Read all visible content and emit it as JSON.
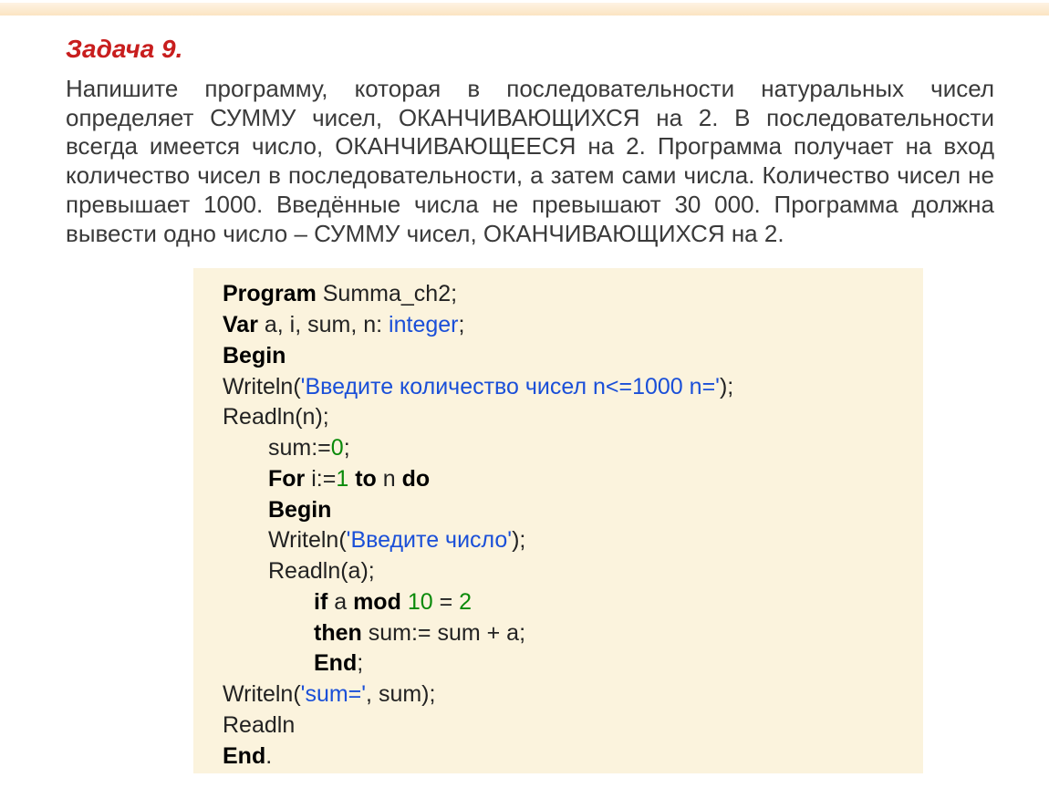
{
  "title": "Задача 9.",
  "problem_html": "Напишите программу, которая в последовательности натуральных чисел определяет СУММУ чисел, ОКАНЧИВАЮЩИХСЯ на 2. В последовательности всегда имеется число, ОКАНЧИВАЮЩЕЕСЯ на 2. Программа получает на вход количество чисел в последовательности, а затем сами числа. Количество чисел не превышает 1000. Введённые числа не превышают 30 000. Программа должна вывести одно число – СУММУ чисел, ОКАНЧИВАЮЩИХСЯ на 2.",
  "code": {
    "l01_kw": "Program",
    "l01_rest": " Summa_ch2;",
    "l02_kw": "Var",
    "l02_mid": " a, i, sum, n: ",
    "l02_type": "integer",
    "l02_end": ";",
    "l03_kw": "Begin",
    "l04_a": "Writeln(",
    "l04_str": "'Введите количество чисел n<=1000 n='",
    "l04_b": ");",
    "l05": "Readln(n);",
    "l06_a": "sum:=",
    "l06_num": "0",
    "l06_b": ";",
    "l07_for": "For",
    "l07_mid1": " i:=",
    "l07_one": "1",
    "l07_mid2": " ",
    "l07_to": "to",
    "l07_mid3": " n ",
    "l07_do": "do",
    "l08_kw": "Begin",
    "l09_a": "Writeln(",
    "l09_str": "'Введите число'",
    "l09_b": ");",
    "l10": "Readln(a);",
    "l11_if": "if",
    "l11_mid1": " a ",
    "l11_mod": "mod",
    "l11_sp": " ",
    "l11_ten": "10",
    "l11_mid2": " = ",
    "l11_two": "2",
    "l12_then": "then",
    "l12_rest": " sum:= sum + a;",
    "l13_end": "End",
    "l13_semi": ";",
    "l14_a": "Writeln(",
    "l14_str": "'sum='",
    "l14_b": ", sum);",
    "l15": "Readln",
    "l16_end": "End",
    "l16_dot": "."
  }
}
